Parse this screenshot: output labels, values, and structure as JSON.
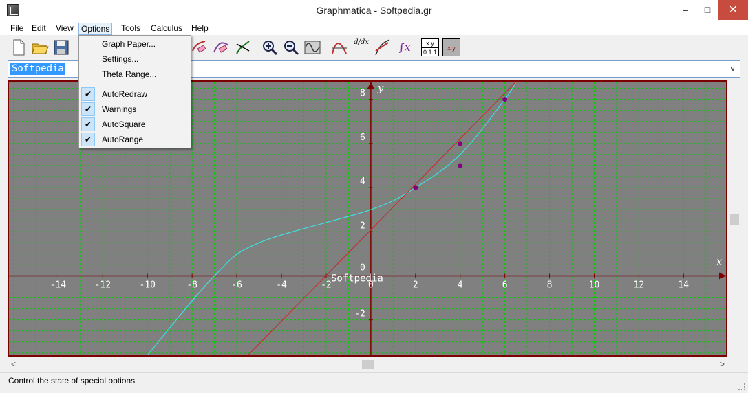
{
  "window": {
    "title": "Graphmatica - Softpedia.gr",
    "minimize_icon": "–",
    "maximize_icon": "□",
    "close_icon": "✕"
  },
  "menubar": {
    "items": [
      "File",
      "Edit",
      "View",
      "Options",
      "Tools",
      "Calculus",
      "Help"
    ],
    "active": "Options"
  },
  "options_menu": {
    "items": [
      {
        "label": "Graph Paper...",
        "checked": false
      },
      {
        "label": "Settings...",
        "checked": false
      },
      {
        "label": "Theta Range...",
        "checked": false
      },
      {
        "label": "AutoRedraw",
        "checked": true
      },
      {
        "label": "Warnings",
        "checked": true
      },
      {
        "label": "AutoSquare",
        "checked": true
      },
      {
        "label": "AutoRange",
        "checked": true
      }
    ],
    "check_glyph": "✔"
  },
  "toolbar": {
    "tools": [
      "new-file-icon",
      "open-folder-icon",
      "save-icon",
      "eraser-icon",
      "eraser-curve-icon",
      "tangent-icon",
      "zoom-in-icon",
      "zoom-out-icon",
      "wave-icon",
      "curve-fit-icon",
      "derivative-icon",
      "tangent-line-icon",
      "integral-icon",
      "table-icon",
      "table-edit-icon"
    ],
    "derivative_label": "d/dx",
    "integral_label": "∫x",
    "table_header": "x y",
    "table_values": "0 1.1"
  },
  "equation_input": {
    "value": "Softpedia",
    "dropdown_icon": "∨"
  },
  "graph": {
    "watermark": "Softpedia",
    "x_axis_label": "x",
    "y_axis_label": "y",
    "colors": {
      "background": "#808080",
      "grid": "#00cc00",
      "axis": "#7d0000",
      "curve": "#40e0e0",
      "line": "#c03030",
      "point": "#800080"
    }
  },
  "chart_data": {
    "type": "line",
    "title": "",
    "xlabel": "x",
    "ylabel": "y",
    "xlim": [
      -16.2,
      15.9
    ],
    "ylim": [
      -3.6,
      8.8
    ],
    "x_ticks": [
      -14,
      -12,
      -10,
      -8,
      -6,
      -4,
      -2,
      0,
      2,
      4,
      6,
      8,
      10,
      12,
      14
    ],
    "y_ticks": [
      -2,
      0,
      2,
      4,
      6,
      8
    ],
    "grid": true,
    "series": [
      {
        "type": "cubic-curve",
        "points": [
          [
            -10,
            -3.6
          ],
          [
            -7,
            0
          ],
          [
            -5,
            1.5
          ],
          [
            0,
            3
          ],
          [
            2,
            4
          ],
          [
            4,
            5.5
          ],
          [
            6,
            8
          ],
          [
            6.5,
            8.8
          ]
        ]
      },
      {
        "type": "line",
        "points": [
          [
            -5.5,
            -3.6
          ],
          [
            2,
            4
          ],
          [
            6.5,
            8.8
          ]
        ]
      },
      {
        "type": "points",
        "points": [
          [
            2,
            4
          ],
          [
            4,
            6
          ],
          [
            4,
            5
          ],
          [
            6,
            8
          ]
        ]
      }
    ]
  },
  "scrollbars": {
    "left_arrow": "<",
    "right_arrow": ">"
  },
  "status": {
    "text": "Control the state of special options"
  }
}
